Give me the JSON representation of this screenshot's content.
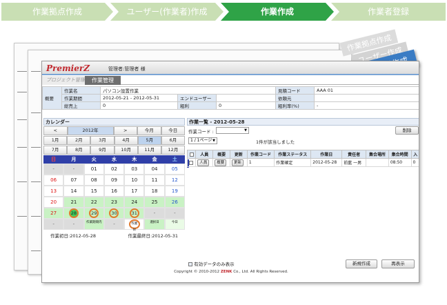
{
  "steps": [
    {
      "label": "作業拠点作成"
    },
    {
      "label": "ユーザー(作業者)作成"
    },
    {
      "label": "作業作成"
    },
    {
      "label": "作業者登録"
    }
  ],
  "ribbons": [
    "作業拠点作成",
    "ユーザー作成",
    "作業作成"
  ],
  "app": {
    "logo": "PremierZ",
    "user": "管理者:管理者 様",
    "tabs": [
      "プロジェクト管理",
      "作業管理"
    ],
    "summary": {
      "section": "概要",
      "name_label": "作業名",
      "name": "パソコン設置作業",
      "code_label": "見積コード",
      "code": "AAA 01",
      "period_label": "作業期間",
      "period": "2012-05-21 - 2012-05-31",
      "enduser_label": "エンドユーザー",
      "enduser": "",
      "client_label": "依頼元",
      "client": "",
      "sales_label": "総売上",
      "sales": "0",
      "profit_label": "粗利",
      "profit": "0",
      "rate_label": "粗利率(%)",
      "rate": "-"
    },
    "calendar": {
      "title": "カレンダー",
      "prev": "<",
      "year": "2012年",
      "next": ">",
      "this_month": "今月",
      "today": "今日",
      "months": [
        "1月",
        "2月",
        "3月",
        "4月",
        "5月",
        "6月",
        "7月",
        "8月",
        "9月",
        "10月",
        "11月",
        "12月"
      ],
      "dow": [
        "日",
        "月",
        "火",
        "水",
        "木",
        "金",
        "土"
      ],
      "weeks": [
        [
          "-",
          "-",
          "01",
          "02",
          "03",
          "04",
          "05"
        ],
        [
          "06",
          "07",
          "08",
          "09",
          "10",
          "11",
          "12"
        ],
        [
          "13",
          "14",
          "15",
          "16",
          "17",
          "18",
          "19"
        ],
        [
          "20",
          "21",
          "22",
          "23",
          "24",
          "25",
          "26"
        ],
        [
          "27",
          "28",
          "29",
          "30",
          "31",
          "-",
          "-"
        ]
      ],
      "legend": [
        "-",
        "-",
        "作業期間内",
        "-",
        "作業日",
        "選択日",
        "今日"
      ],
      "first_day": "作業初日:2012-05-28",
      "last_day": "作業最終日:2012-05-31"
    },
    "tasks": {
      "title": "作業一覧 - 2012-05-28",
      "code_label": "作業コード :",
      "code_value": "",
      "delete": "削除",
      "page": "1 / 1ページ",
      "count": "1件が該当しました",
      "headers": [
        "",
        "人員",
        "概要",
        "更新",
        "作業コード",
        "作業ステータス",
        "作業日",
        "責任者",
        "集合場所",
        "集合時間",
        "入"
      ],
      "rows": [
        {
          "person": "人員",
          "overview": "概要",
          "update": "更新",
          "code": "1",
          "status": "作業確定",
          "date": "2012-05-28",
          "leader": "前藍 一男",
          "place": "",
          "time": "08:50",
          "extra": "0"
        }
      ],
      "filter": "有効データのみ表示",
      "new_button": "新規作成",
      "refresh_button": "再表示"
    },
    "copyright_pre": "Copyright © 2010-2012 ",
    "copyright_brand": "ZENK",
    "copyright_post": " Co., Ltd. All Rights Reserved."
  }
}
